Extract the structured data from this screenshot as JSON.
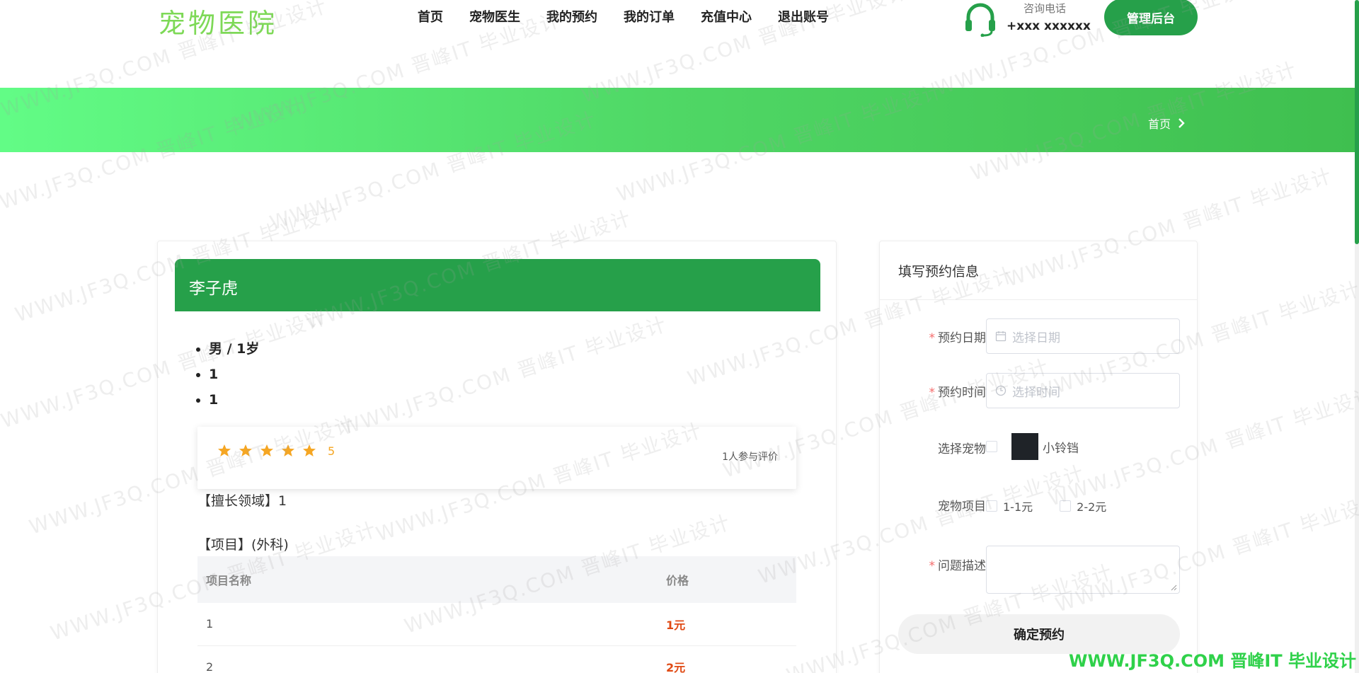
{
  "header": {
    "logo": "宠物医院",
    "nav": [
      "首页",
      "宠物医生",
      "我的预约",
      "我的订单",
      "充值中心",
      "退出账号"
    ],
    "phone_label": "咨询电话",
    "phone_number": "+xxx xxxxxx",
    "admin_button": "管理后台"
  },
  "banner": {
    "breadcrumb": "首页"
  },
  "doctor": {
    "name": "李子虎",
    "info": [
      "男 / 1岁",
      "1",
      "1"
    ],
    "rating": {
      "stars": 5,
      "value": "5",
      "count_text": "1人参与评价"
    },
    "specialty": "【擅长领域】1",
    "project_title": "【项目】(外科)",
    "table": {
      "headers": [
        "项目名称",
        "价格"
      ],
      "rows": [
        [
          "1",
          "1元"
        ],
        [
          "2",
          "2元"
        ]
      ]
    }
  },
  "form": {
    "title": "填写预约信息",
    "date_label": "预约日期",
    "date_placeholder": "选择日期",
    "time_label": "预约时间",
    "time_placeholder": "选择时间",
    "pet_label": "选择宠物",
    "pet_name": "小铃铛",
    "item_label": "宠物项目",
    "items": [
      "1-1元",
      "2-2元"
    ],
    "desc_label": "问题描述",
    "submit": "确定预约",
    "required_mark": "*"
  },
  "watermark": {
    "text": "WWW.JF3Q.COM 晋峰IT 毕业设计",
    "corner": "WWW.JF3Q.COM 晋峰IT 毕业设计"
  },
  "colors": {
    "primary": "#26a04a",
    "logo": "#7ed957",
    "star": "#f5a623",
    "price": "#e04a14"
  }
}
